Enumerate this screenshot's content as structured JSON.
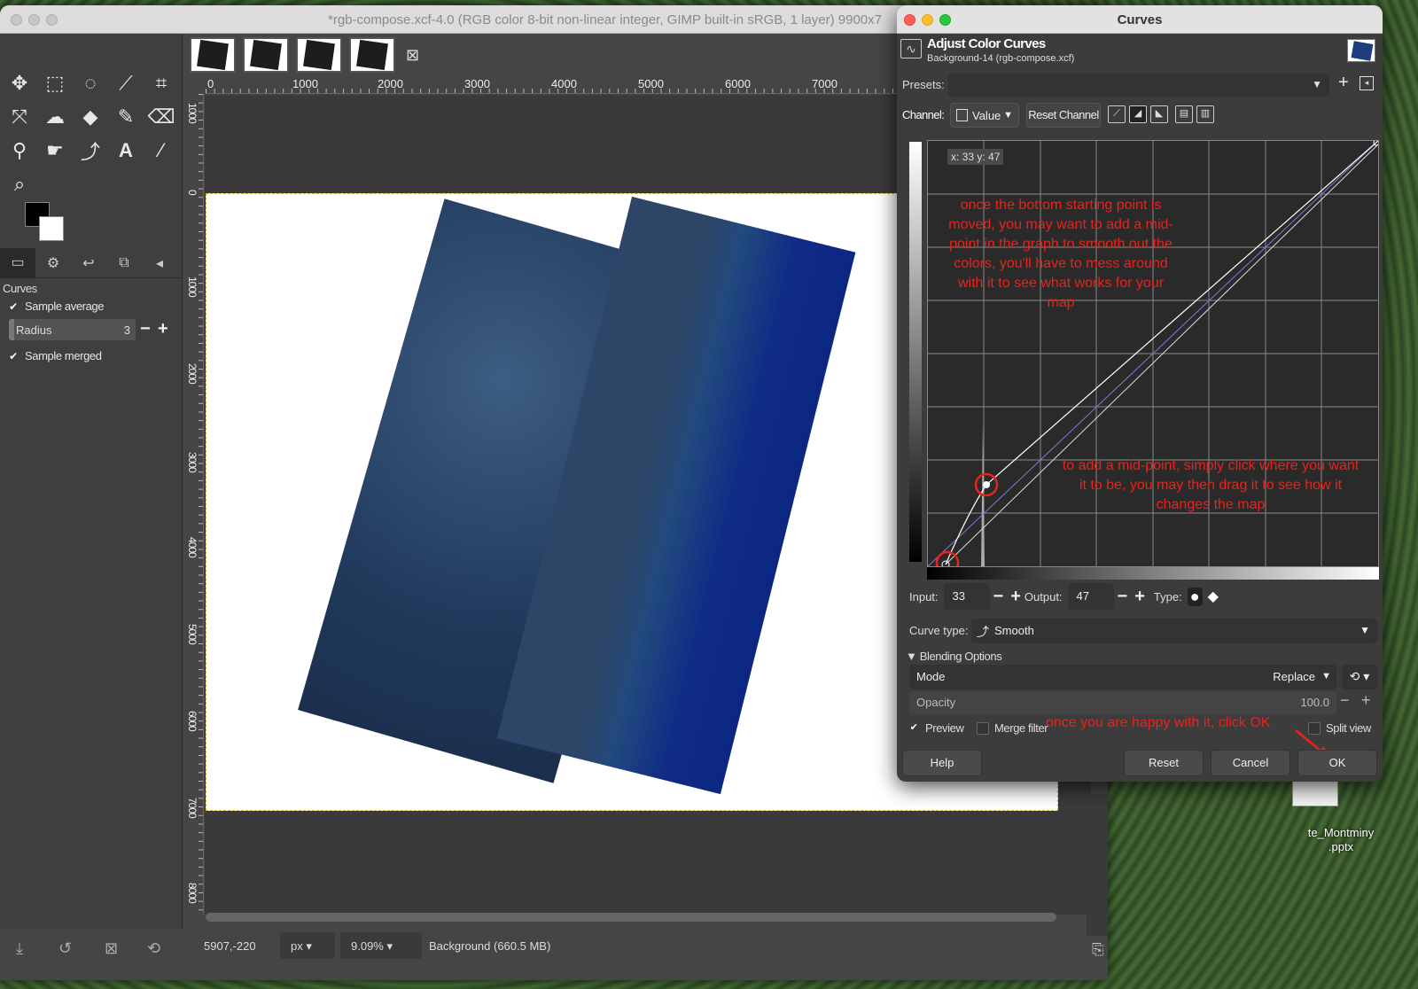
{
  "gimp": {
    "window_title": "*rgb-compose.xcf-4.0 (RGB color 8-bit non-linear integer, GIMP built-in sRGB, 1 layer) 9900x7",
    "tool_options_title": "Curves",
    "sample_average_label": "Sample average",
    "radius_label": "Radius",
    "radius_value": "3",
    "sample_merged_label": "Sample merged",
    "ruler_top_labels": [
      "0",
      "1000",
      "2000",
      "3000",
      "4000",
      "5000",
      "6000",
      "7000"
    ],
    "ruler_left_labels": [
      "1000",
      "0",
      "1000",
      "2000",
      "3000",
      "4000",
      "5000",
      "6000",
      "7000",
      "8000"
    ],
    "status": {
      "coords": "5907,-220",
      "unit": "px",
      "zoom": "9.09%",
      "layer_info": "Background (660.5 MB)"
    }
  },
  "desktop": {
    "file_label_line1": "te_Montminy",
    "file_label_line2": ".pptx"
  },
  "curves": {
    "window_title": "Curves",
    "header_title": "Adjust Color Curves",
    "header_subtitle": "Background-14 (rgb-compose.xcf)",
    "presets_label": "Presets:",
    "channel_label": "Channel:",
    "channel_value": "Value",
    "reset_channel_label": "Reset Channel",
    "xy_readout": "x: 33 y: 47",
    "annotation_1": "once the bottom starting point is moved, you may want to add a mid-point in the graph to smooth out the colors, you'll have to mess around with it to see what works for your map",
    "annotation_2": "to add a mid-point, simply click where you want it to be, you may then drag it to see how it changes the map",
    "annotation_ok": "once you are happy with it, click OK",
    "input_label": "Input:",
    "input_value": "33",
    "output_label": "Output:",
    "output_value": "47",
    "type_label": "Type:",
    "curve_type_label": "Curve type:",
    "curve_type_value": "Smooth",
    "blending_options_label": "Blending Options",
    "mode_label": "Mode",
    "mode_value": "Replace",
    "opacity_label": "Opacity",
    "opacity_value": "100.0",
    "preview_label": "Preview",
    "merge_filter_label": "Merge filter",
    "split_view_label": "Split view",
    "buttons": {
      "help": "Help",
      "reset": "Reset",
      "cancel": "Cancel",
      "ok": "OK"
    }
  },
  "colors": {
    "annotation": "#e8231b",
    "dialog_bg": "#3c3c3c",
    "water": "#0c2783"
  }
}
